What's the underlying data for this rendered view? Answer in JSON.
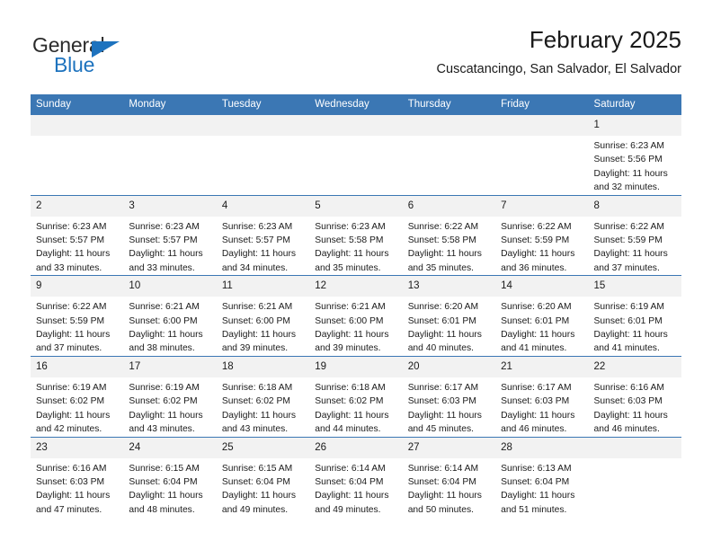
{
  "brand": {
    "name_part1": "General",
    "name_part2": "Blue",
    "accent_color": "#1e73be",
    "triangle_icon": "triangle-icon"
  },
  "header": {
    "title": "February 2025",
    "subtitle": "Cuscatancingo, San Salvador, El Salvador"
  },
  "calendar": {
    "header_bg": "#3b77b4",
    "daynum_bg": "#f2f2f2",
    "weekdays": [
      "Sunday",
      "Monday",
      "Tuesday",
      "Wednesday",
      "Thursday",
      "Friday",
      "Saturday"
    ],
    "weeks": [
      [
        {
          "day": "",
          "blank": true
        },
        {
          "day": "",
          "blank": true
        },
        {
          "day": "",
          "blank": true
        },
        {
          "day": "",
          "blank": true
        },
        {
          "day": "",
          "blank": true
        },
        {
          "day": "",
          "blank": true
        },
        {
          "day": "1",
          "sunrise": "Sunrise: 6:23 AM",
          "sunset": "Sunset: 5:56 PM",
          "daylight": "Daylight: 11 hours and 32 minutes."
        }
      ],
      [
        {
          "day": "2",
          "sunrise": "Sunrise: 6:23 AM",
          "sunset": "Sunset: 5:57 PM",
          "daylight": "Daylight: 11 hours and 33 minutes."
        },
        {
          "day": "3",
          "sunrise": "Sunrise: 6:23 AM",
          "sunset": "Sunset: 5:57 PM",
          "daylight": "Daylight: 11 hours and 33 minutes."
        },
        {
          "day": "4",
          "sunrise": "Sunrise: 6:23 AM",
          "sunset": "Sunset: 5:57 PM",
          "daylight": "Daylight: 11 hours and 34 minutes."
        },
        {
          "day": "5",
          "sunrise": "Sunrise: 6:23 AM",
          "sunset": "Sunset: 5:58 PM",
          "daylight": "Daylight: 11 hours and 35 minutes."
        },
        {
          "day": "6",
          "sunrise": "Sunrise: 6:22 AM",
          "sunset": "Sunset: 5:58 PM",
          "daylight": "Daylight: 11 hours and 35 minutes."
        },
        {
          "day": "7",
          "sunrise": "Sunrise: 6:22 AM",
          "sunset": "Sunset: 5:59 PM",
          "daylight": "Daylight: 11 hours and 36 minutes."
        },
        {
          "day": "8",
          "sunrise": "Sunrise: 6:22 AM",
          "sunset": "Sunset: 5:59 PM",
          "daylight": "Daylight: 11 hours and 37 minutes."
        }
      ],
      [
        {
          "day": "9",
          "sunrise": "Sunrise: 6:22 AM",
          "sunset": "Sunset: 5:59 PM",
          "daylight": "Daylight: 11 hours and 37 minutes."
        },
        {
          "day": "10",
          "sunrise": "Sunrise: 6:21 AM",
          "sunset": "Sunset: 6:00 PM",
          "daylight": "Daylight: 11 hours and 38 minutes."
        },
        {
          "day": "11",
          "sunrise": "Sunrise: 6:21 AM",
          "sunset": "Sunset: 6:00 PM",
          "daylight": "Daylight: 11 hours and 39 minutes."
        },
        {
          "day": "12",
          "sunrise": "Sunrise: 6:21 AM",
          "sunset": "Sunset: 6:00 PM",
          "daylight": "Daylight: 11 hours and 39 minutes."
        },
        {
          "day": "13",
          "sunrise": "Sunrise: 6:20 AM",
          "sunset": "Sunset: 6:01 PM",
          "daylight": "Daylight: 11 hours and 40 minutes."
        },
        {
          "day": "14",
          "sunrise": "Sunrise: 6:20 AM",
          "sunset": "Sunset: 6:01 PM",
          "daylight": "Daylight: 11 hours and 41 minutes."
        },
        {
          "day": "15",
          "sunrise": "Sunrise: 6:19 AM",
          "sunset": "Sunset: 6:01 PM",
          "daylight": "Daylight: 11 hours and 41 minutes."
        }
      ],
      [
        {
          "day": "16",
          "sunrise": "Sunrise: 6:19 AM",
          "sunset": "Sunset: 6:02 PM",
          "daylight": "Daylight: 11 hours and 42 minutes."
        },
        {
          "day": "17",
          "sunrise": "Sunrise: 6:19 AM",
          "sunset": "Sunset: 6:02 PM",
          "daylight": "Daylight: 11 hours and 43 minutes."
        },
        {
          "day": "18",
          "sunrise": "Sunrise: 6:18 AM",
          "sunset": "Sunset: 6:02 PM",
          "daylight": "Daylight: 11 hours and 43 minutes."
        },
        {
          "day": "19",
          "sunrise": "Sunrise: 6:18 AM",
          "sunset": "Sunset: 6:02 PM",
          "daylight": "Daylight: 11 hours and 44 minutes."
        },
        {
          "day": "20",
          "sunrise": "Sunrise: 6:17 AM",
          "sunset": "Sunset: 6:03 PM",
          "daylight": "Daylight: 11 hours and 45 minutes."
        },
        {
          "day": "21",
          "sunrise": "Sunrise: 6:17 AM",
          "sunset": "Sunset: 6:03 PM",
          "daylight": "Daylight: 11 hours and 46 minutes."
        },
        {
          "day": "22",
          "sunrise": "Sunrise: 6:16 AM",
          "sunset": "Sunset: 6:03 PM",
          "daylight": "Daylight: 11 hours and 46 minutes."
        }
      ],
      [
        {
          "day": "23",
          "sunrise": "Sunrise: 6:16 AM",
          "sunset": "Sunset: 6:03 PM",
          "daylight": "Daylight: 11 hours and 47 minutes."
        },
        {
          "day": "24",
          "sunrise": "Sunrise: 6:15 AM",
          "sunset": "Sunset: 6:04 PM",
          "daylight": "Daylight: 11 hours and 48 minutes."
        },
        {
          "day": "25",
          "sunrise": "Sunrise: 6:15 AM",
          "sunset": "Sunset: 6:04 PM",
          "daylight": "Daylight: 11 hours and 49 minutes."
        },
        {
          "day": "26",
          "sunrise": "Sunrise: 6:14 AM",
          "sunset": "Sunset: 6:04 PM",
          "daylight": "Daylight: 11 hours and 49 minutes."
        },
        {
          "day": "27",
          "sunrise": "Sunrise: 6:14 AM",
          "sunset": "Sunset: 6:04 PM",
          "daylight": "Daylight: 11 hours and 50 minutes."
        },
        {
          "day": "28",
          "sunrise": "Sunrise: 6:13 AM",
          "sunset": "Sunset: 6:04 PM",
          "daylight": "Daylight: 11 hours and 51 minutes."
        },
        {
          "day": "",
          "blank": true
        }
      ]
    ]
  }
}
